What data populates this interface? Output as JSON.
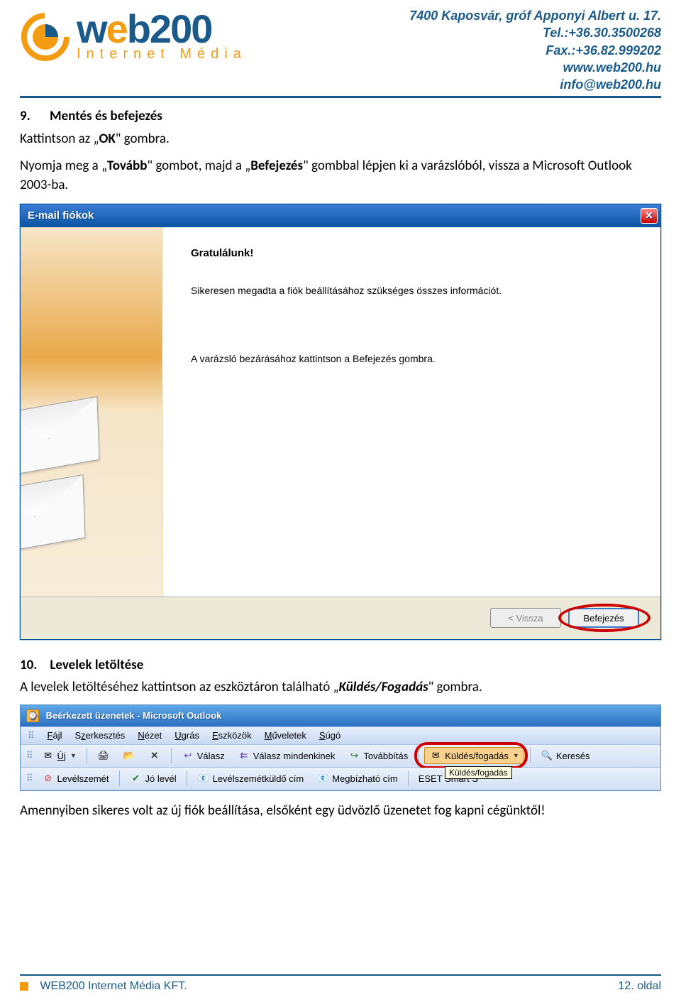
{
  "header": {
    "brand_main": "web200",
    "brand_sub": "Internet Média",
    "contact": {
      "addr": "7400 Kaposvár, gróf Apponyi Albert u. 17.",
      "tel": "Tel.:+36.30.3500268",
      "fax": "Fax.:+36.82.999202",
      "web": "www.web200.hu",
      "email": "info@web200.hu"
    }
  },
  "section9": {
    "num": "9.",
    "title": "Mentés és befejezés",
    "line1_a": "Kattintson az „",
    "line1_b": "OK",
    "line1_c": "\" gombra.",
    "line2_a": "Nyomja meg a „",
    "line2_b": "Tovább",
    "line2_c": "\" gombot, majd a „",
    "line2_d": "Befejezés",
    "line2_e": "\" gombbal lépjen ki a varázslóból, vissza a Microsoft Outlook 2003-ba."
  },
  "wizard": {
    "title": "E-mail fiókok",
    "heading": "Gratulálunk!",
    "p1": "Sikeresen megadta a fiók beállításához szükséges összes információt.",
    "p2": "A varázsló bezárásához kattintson a Befejezés gombra.",
    "back": "< Vissza",
    "finish": "Befejezés"
  },
  "section10": {
    "num": "10.",
    "title": "Levelek letöltése",
    "text_a": "A levelek letöltéséhez kattintson az eszköztáron található „",
    "text_b": "Küldés/Fogadás",
    "text_c": "\" gombra."
  },
  "outlook": {
    "title": "Beérkezett üzenetek - Microsoft Outlook",
    "menu": [
      "Fájl",
      "Szerkesztés",
      "Nézet",
      "Ugrás",
      "Eszközök",
      "Műveletek",
      "Súgó"
    ],
    "row1": {
      "new": "Új",
      "reply": "Válasz",
      "replyall": "Válasz mindenkinek",
      "forward": "Továbbítás",
      "sendrecv": "Küldés/fogadás",
      "search": "Keresés"
    },
    "row2": {
      "junk": "Levélszemét",
      "good": "Jó levél",
      "junkaddr": "Levélszemétküldő cím",
      "trustaddr": "Megbízható cím",
      "eset": "ESET Smart S"
    },
    "tooltip": "Küldés/fogadás"
  },
  "closing": "Amennyiben sikeres volt az új fiók beállítása, elsőként egy üdvözlő üzenetet fog kapni cégünktől!",
  "footer": {
    "company": "WEB200 Internet Média KFT.",
    "page": "12. oldal"
  }
}
